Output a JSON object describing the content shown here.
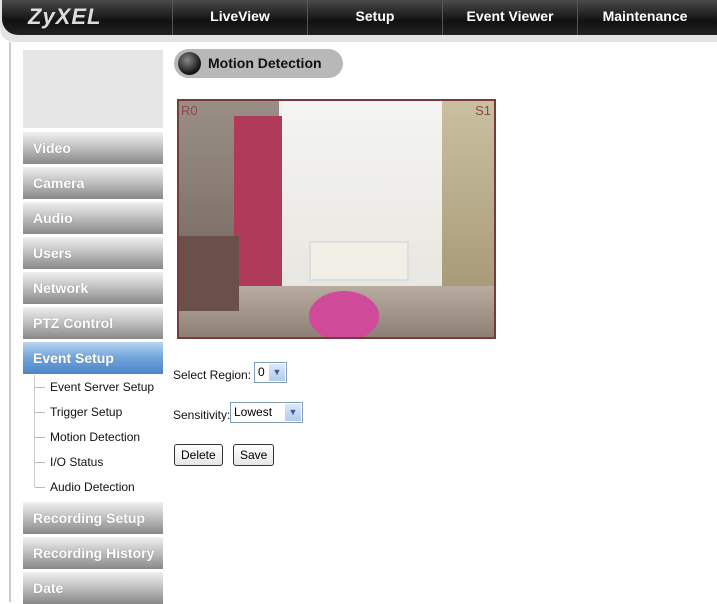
{
  "brand": "ZyXEL",
  "nav": [
    "LiveView",
    "Setup",
    "Event Viewer",
    "Maintenance"
  ],
  "sidebar": {
    "items": [
      "Video",
      "Camera",
      "Audio",
      "Users",
      "Network",
      "PTZ Control",
      "Event Setup",
      "Recording Setup",
      "Recording History",
      "Date"
    ],
    "active": "Event Setup",
    "subitems": [
      "Event Server Setup",
      "Trigger Setup",
      "Motion Detection",
      "I/O Status",
      "Audio Detection"
    ]
  },
  "page": {
    "title": "Motion Detection"
  },
  "camera": {
    "region_label": "R0",
    "sensitivity_label": "S1"
  },
  "form": {
    "region_label": "Select Region:",
    "region_value": "0",
    "sensitivity_label": "Sensitivity:",
    "sensitivity_value": "Lowest",
    "delete": "Delete",
    "save": "Save"
  },
  "colors": {
    "active": "#6fa3dc",
    "navbar": "#111111"
  }
}
